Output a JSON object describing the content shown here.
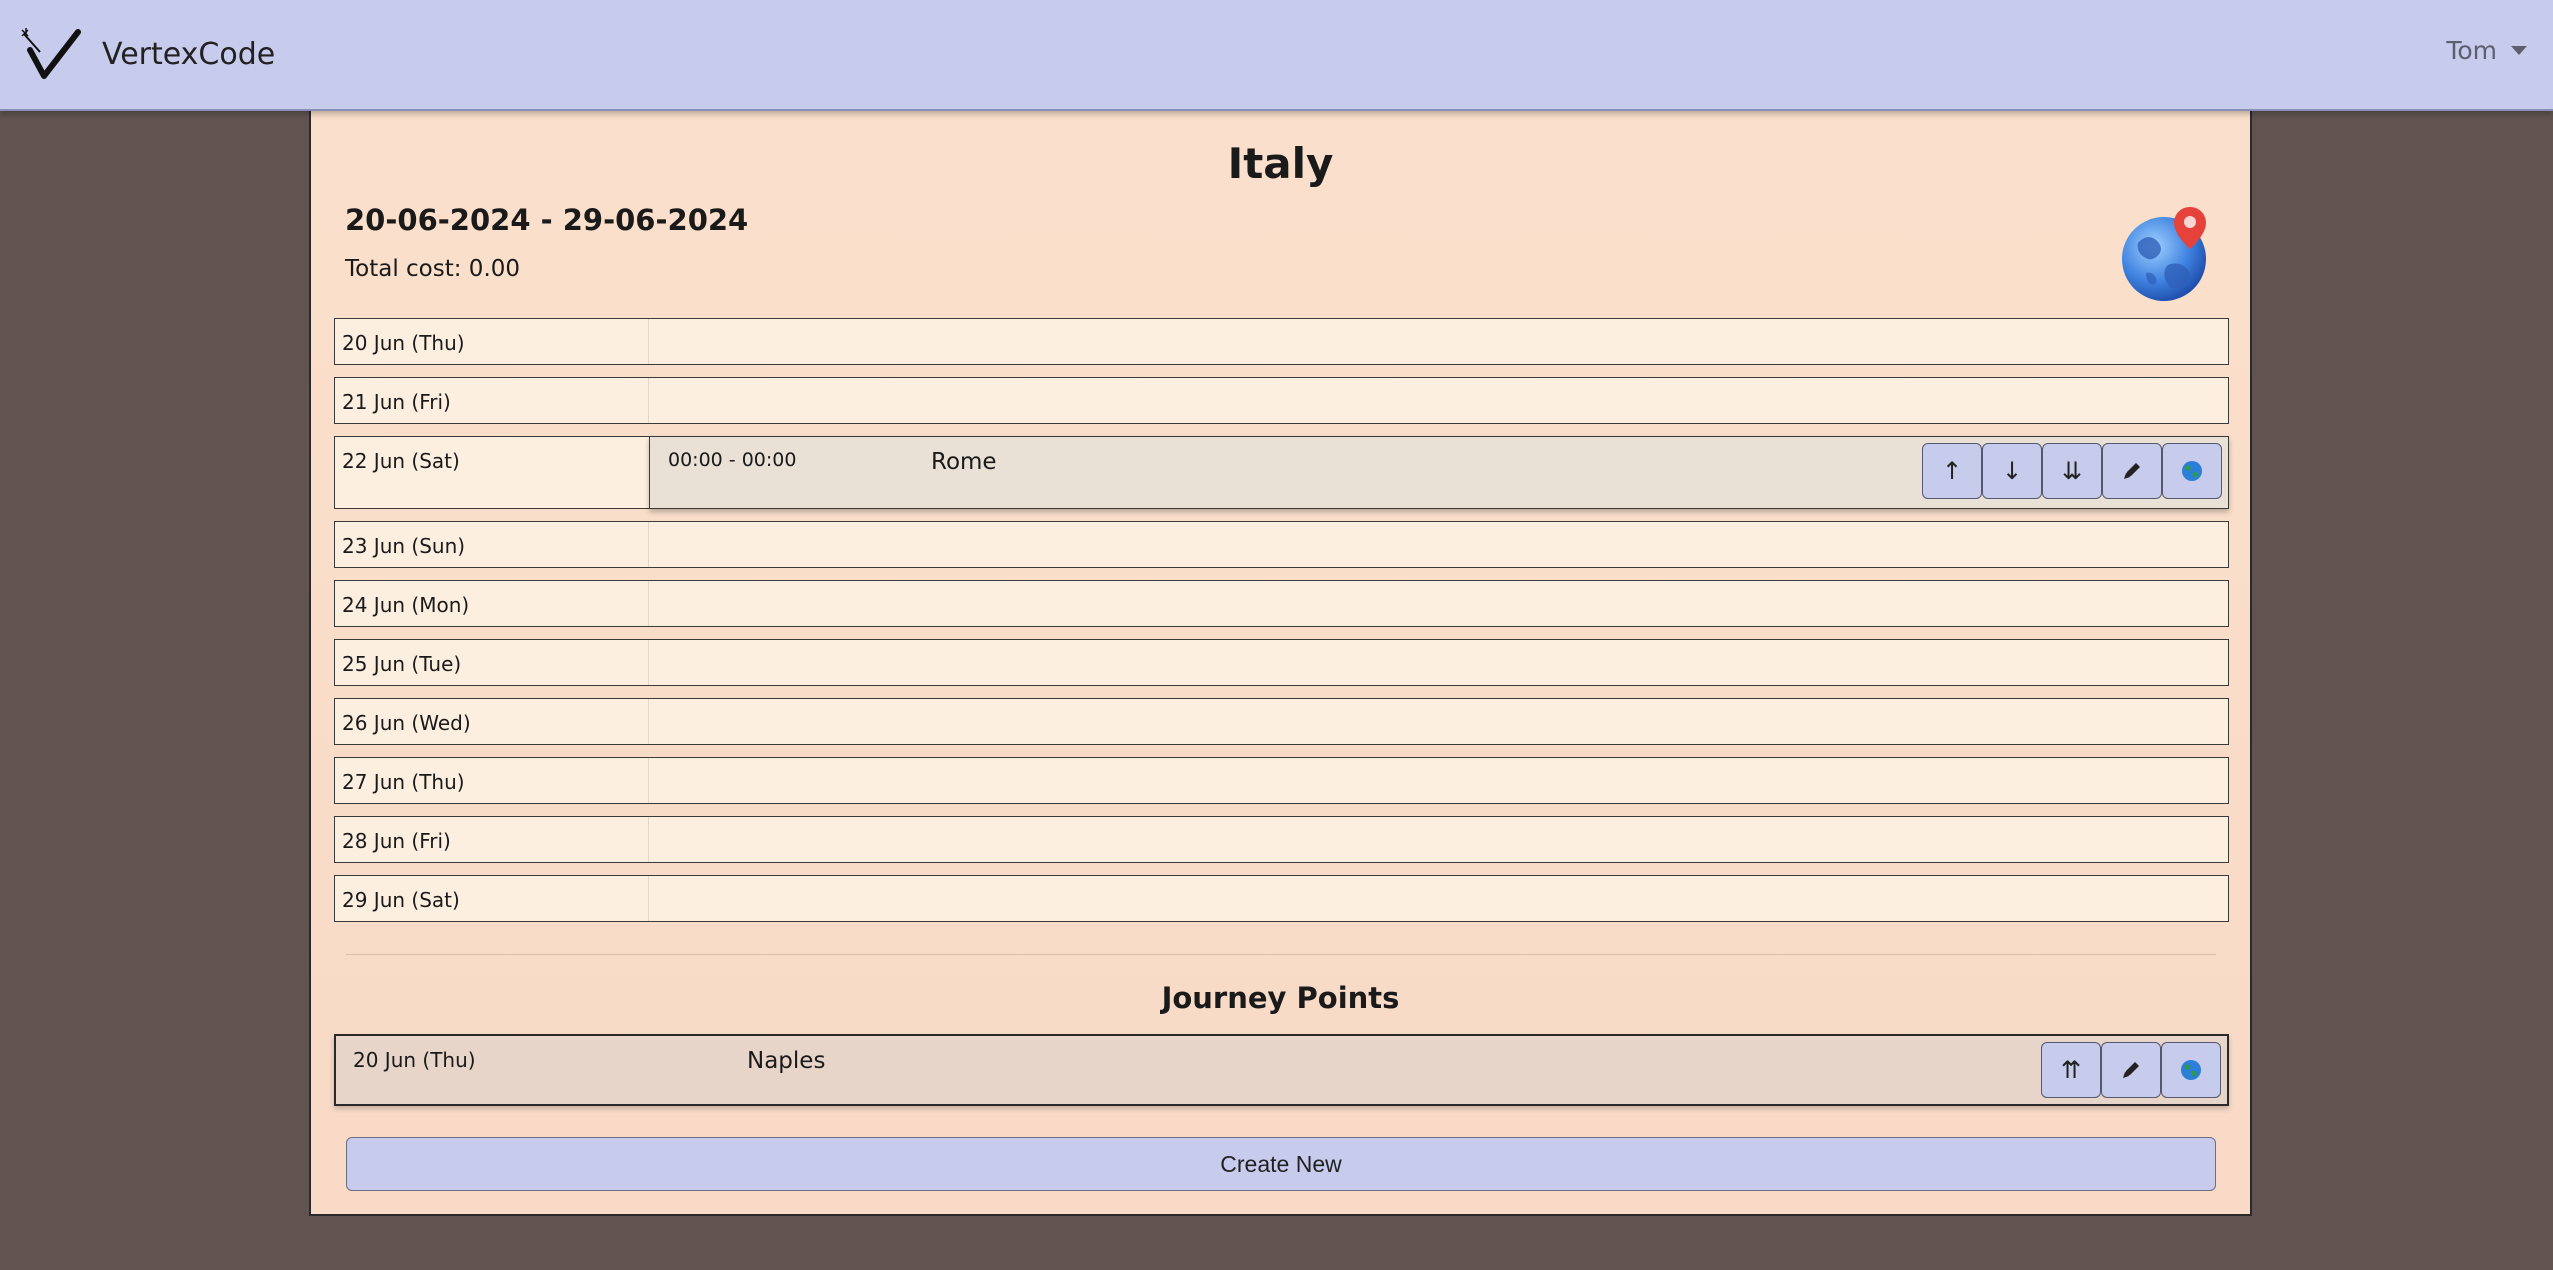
{
  "navbar": {
    "brand": "VertexCode",
    "user": "Tom"
  },
  "trip": {
    "title": "Italy",
    "dates": "20-06-2024 - 29-06-2024",
    "total_cost": "Total cost: 0.00"
  },
  "days": [
    {
      "label": "20 Jun (Thu)"
    },
    {
      "label": "21 Jun (Fri)"
    },
    {
      "label": "22 Jun (Sat)",
      "event": {
        "time": "00:00 - 00:00",
        "place": "Rome"
      }
    },
    {
      "label": "23 Jun (Sun)"
    },
    {
      "label": "24 Jun (Mon)"
    },
    {
      "label": "25 Jun (Tue)"
    },
    {
      "label": "26 Jun (Wed)"
    },
    {
      "label": "27 Jun (Thu)"
    },
    {
      "label": "28 Jun (Fri)"
    },
    {
      "label": "29 Jun (Sat)"
    }
  ],
  "event_buttons": {
    "up": "↑",
    "down": "↓",
    "bottom": "⇊"
  },
  "journey": {
    "title": "Journey Points",
    "points": [
      {
        "date": "20 Jun (Thu)",
        "place": "Naples"
      }
    ],
    "top_button": "⇈"
  },
  "create_button": "Create New",
  "colors": {
    "navbar": "#c7cbec",
    "background": "#615450",
    "card": "#fae0cc",
    "row": "#fcefe0",
    "event": "#e9e0d6",
    "button": "#c7cbec"
  },
  "icons": {
    "edit": "pencil-icon",
    "map": "globe-icon",
    "trip": "globe-pin-icon"
  }
}
